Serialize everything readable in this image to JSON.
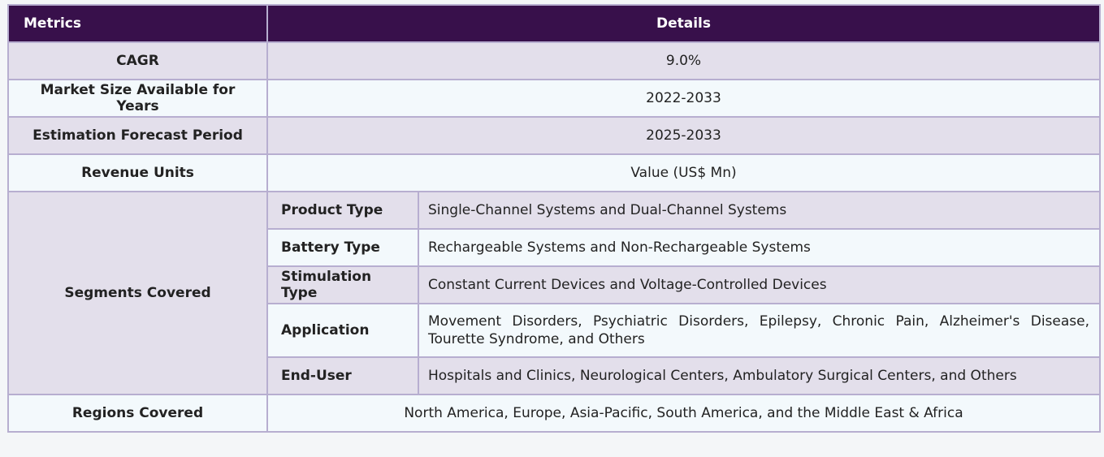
{
  "table": {
    "header": {
      "metrics": "Metrics",
      "details": "Details"
    },
    "rows": {
      "cagr": {
        "metric": "CAGR",
        "value": "9.0%"
      },
      "market_size": {
        "metric": "Market Size Available for Years",
        "value": "2022-2033"
      },
      "forecast": {
        "metric": "Estimation Forecast Period",
        "value": "2025-2033"
      },
      "revenue": {
        "metric": "Revenue Units",
        "value": "Value (US$ Mn)"
      },
      "segments": {
        "metric": "Segments Covered",
        "items": [
          {
            "label": "Product Type",
            "value": "Single-Channel Systems and Dual-Channel Systems"
          },
          {
            "label": "Battery Type",
            "value": "Rechargeable Systems and Non-Rechargeable Systems"
          },
          {
            "label": "Stimulation Type",
            "value": "Constant Current Devices and Voltage-Controlled Devices"
          },
          {
            "label": "Application",
            "value": "Movement Disorders, Psychiatric Disorders, Epilepsy, Chronic Pain, Alzheimer's Disease, Tourette Syndrome, and Others"
          },
          {
            "label": "End-User",
            "value": "Hospitals and Clinics, Neurological Centers, Ambulatory Surgical Centers, and Others"
          }
        ]
      },
      "regions": {
        "metric": "Regions Covered",
        "value": "North America, Europe, Asia-Pacific, South America, and the Middle East & Africa"
      }
    }
  },
  "colors": {
    "header_bg": "#38104b",
    "row_lavender": "#e3dfeb",
    "row_light": "#f3f9fc",
    "border": "#b7aed0"
  }
}
